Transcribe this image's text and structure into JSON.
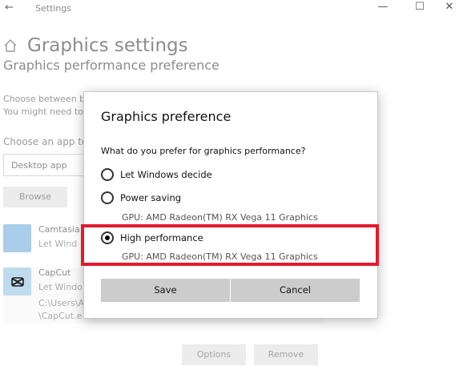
{
  "window": {
    "back_glyph": "←",
    "title": "Settings",
    "minimize_glyph": "—",
    "maximize_glyph": "☐",
    "close_glyph": "✕"
  },
  "page": {
    "title": "Graphics settings",
    "section": "Graphics performance preference",
    "desc_line1": "Choose between b",
    "desc_line2": "You might need to",
    "choose_label": "Choose an app to",
    "app_type_value": "Desktop app",
    "browse_label": "Browse"
  },
  "apps": [
    {
      "name": "Camtasia",
      "sub": "Let Wind"
    },
    {
      "name": "CapCut",
      "sub": "Let Windo",
      "path1": "C:\\Users\\A",
      "path2": "\\CapCut.e"
    }
  ],
  "app_buttons": {
    "options": "Options",
    "remove": "Remove"
  },
  "dialog": {
    "title": "Graphics preference",
    "question": "What do you prefer for graphics performance?",
    "options": [
      {
        "label": "Let Windows decide",
        "selected": false
      },
      {
        "label": "Power saving",
        "selected": false,
        "gpu": "GPU: AMD Radeon(TM) RX Vega 11 Graphics"
      },
      {
        "label": "High performance",
        "selected": true,
        "gpu": "GPU: AMD Radeon(TM) RX Vega 11 Graphics"
      }
    ],
    "save": "Save",
    "cancel": "Cancel"
  },
  "colors": {
    "highlight": "#e21a2d",
    "dialog_button": "#cccccc"
  }
}
